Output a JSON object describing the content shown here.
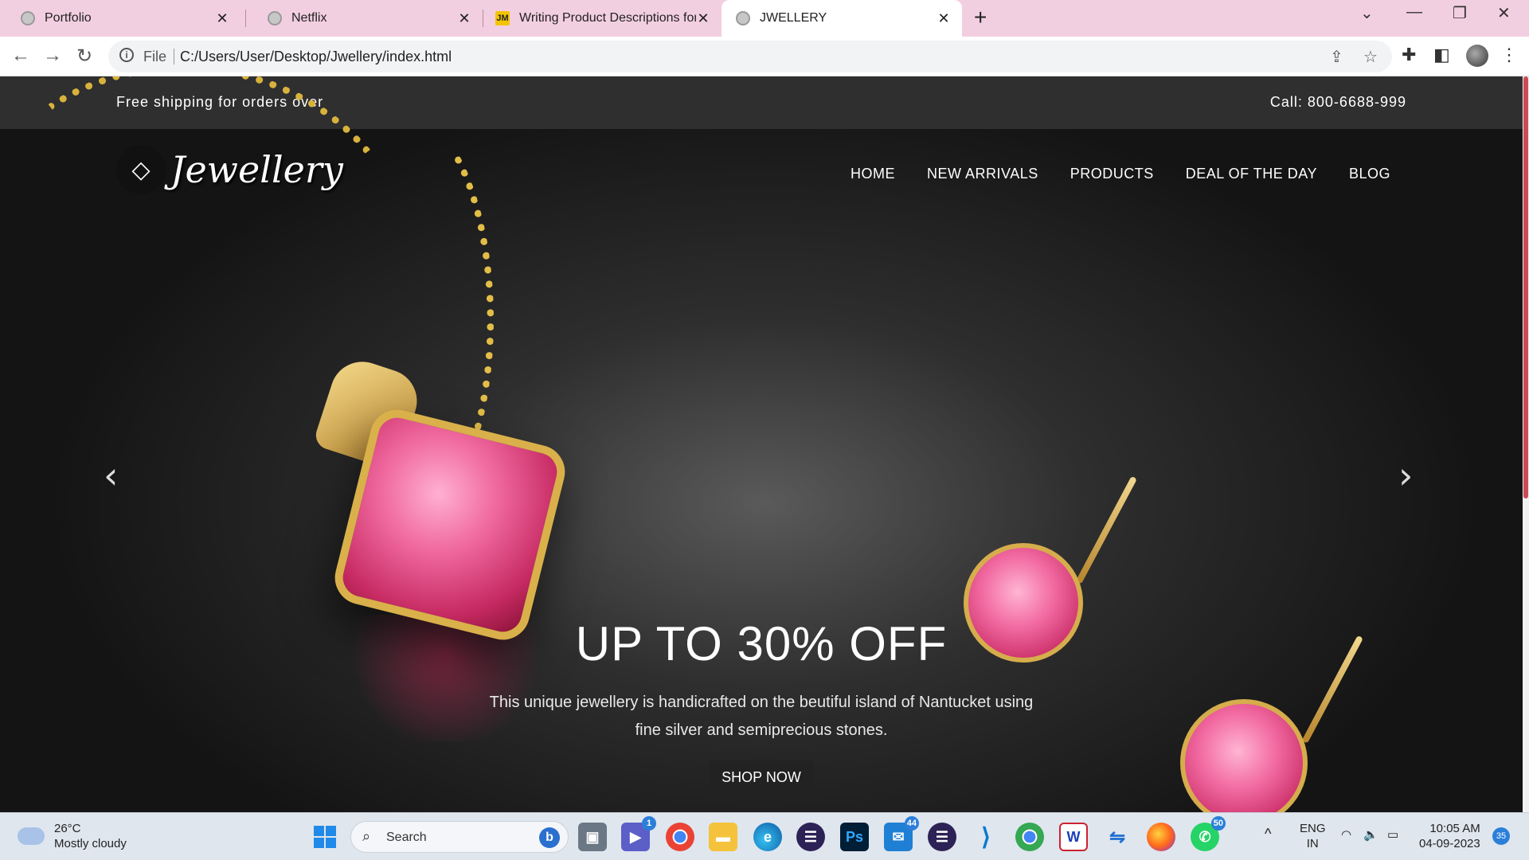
{
  "browser": {
    "tabs": [
      {
        "title": "Portfolio",
        "icon": "globe-icon"
      },
      {
        "title": "Netflix",
        "icon": "globe-icon"
      },
      {
        "title": "Writing Product Descriptions for",
        "icon": "jm-logo-icon",
        "favicon_text": "JM"
      },
      {
        "title": "JWELLERY",
        "icon": "globe-icon",
        "active": true
      }
    ],
    "url_scheme": "File",
    "url": "C:/Users/User/Desktop/Jwellery/index.html"
  },
  "page": {
    "topbar": {
      "shipping": "Free shipping for orders over",
      "call": "Call: 800-6688-999"
    },
    "logo": {
      "name": "Jewellery",
      "icon": "diamond-icon"
    },
    "nav": [
      "HOME",
      "NEW ARRIVALS",
      "PRODUCTS",
      "DEAL OF THE DAY",
      "BLOG"
    ],
    "hero": {
      "heading": "UP TO 30% OFF",
      "text": "This unique jewellery is handicrafted on the beutiful island of Nantucket using fine silver and semiprecious stones.",
      "button": "SHOP NOW"
    },
    "colors": {
      "topbar": "#2f2f2f",
      "gold": "#d8b23c",
      "gem": "#f06aa0"
    }
  },
  "taskbar": {
    "weather": {
      "temp": "26°C",
      "condition": "Mostly cloudy"
    },
    "search_placeholder": "Search",
    "apps": [
      {
        "name": "windows-start"
      },
      {
        "name": "task-view"
      },
      {
        "name": "teams",
        "badge": "1"
      },
      {
        "name": "chrome"
      },
      {
        "name": "file-explorer"
      },
      {
        "name": "edge"
      },
      {
        "name": "eclipse"
      },
      {
        "name": "photoshop",
        "label": "Ps"
      },
      {
        "name": "mail",
        "badge": "44"
      },
      {
        "name": "eclipse-2"
      },
      {
        "name": "vscode"
      },
      {
        "name": "chrome-active"
      },
      {
        "name": "writer",
        "label": "W"
      },
      {
        "name": "remote-app"
      },
      {
        "name": "firefox"
      },
      {
        "name": "whatsapp",
        "badge": "50"
      }
    ],
    "lang": "ENG",
    "region": "IN",
    "time": "10:05 AM",
    "date": "04-09-2023",
    "notifications": "35"
  }
}
